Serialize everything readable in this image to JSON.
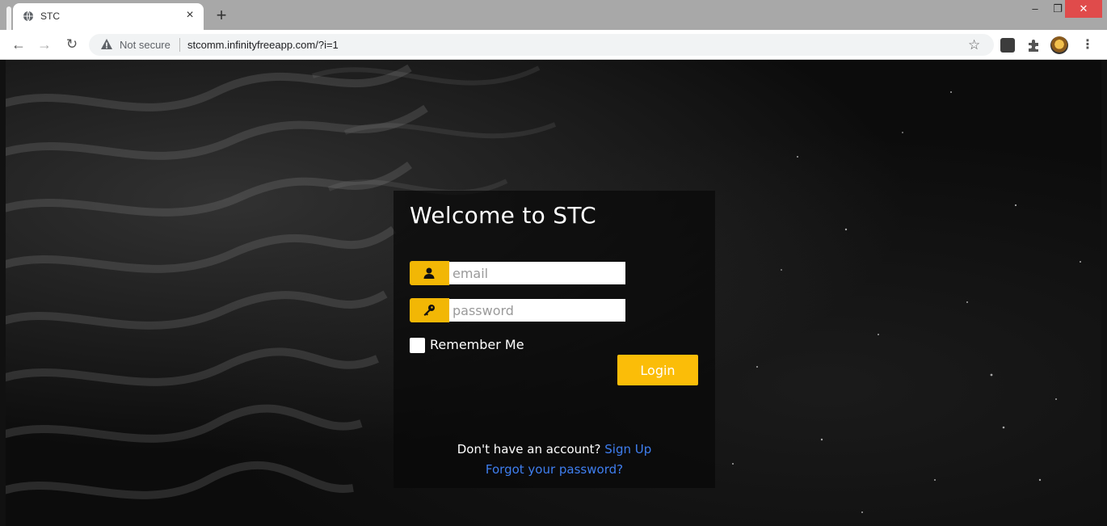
{
  "browser": {
    "tab_title": "STC",
    "tab_close": "×",
    "new_tab": "+",
    "security_label": "Not secure",
    "url": "stcomm.infinityfreeapp.com/?i=1",
    "window_controls": {
      "minimize": "–",
      "maximize": "❐",
      "close": "✕"
    },
    "icons": [
      "globe-icon",
      "back-icon",
      "forward-icon",
      "reload-icon",
      "warning-icon",
      "star-icon",
      "extension-icon",
      "puzzle-icon",
      "profile-avatar",
      "menu-kebab-icon"
    ]
  },
  "login_card": {
    "title": "Welcome to STC",
    "email_placeholder": "email",
    "password_placeholder": "password",
    "remember_label": "Remember Me",
    "login_label": "Login",
    "no_account_text": "Don't have an account?",
    "signup_link": "Sign Up",
    "forgot_link": "Forgot your password?"
  },
  "colors": {
    "accent": "#fbbd08",
    "link": "#3f7ff0",
    "card_bg": "#080808",
    "text": "#ffffff"
  }
}
